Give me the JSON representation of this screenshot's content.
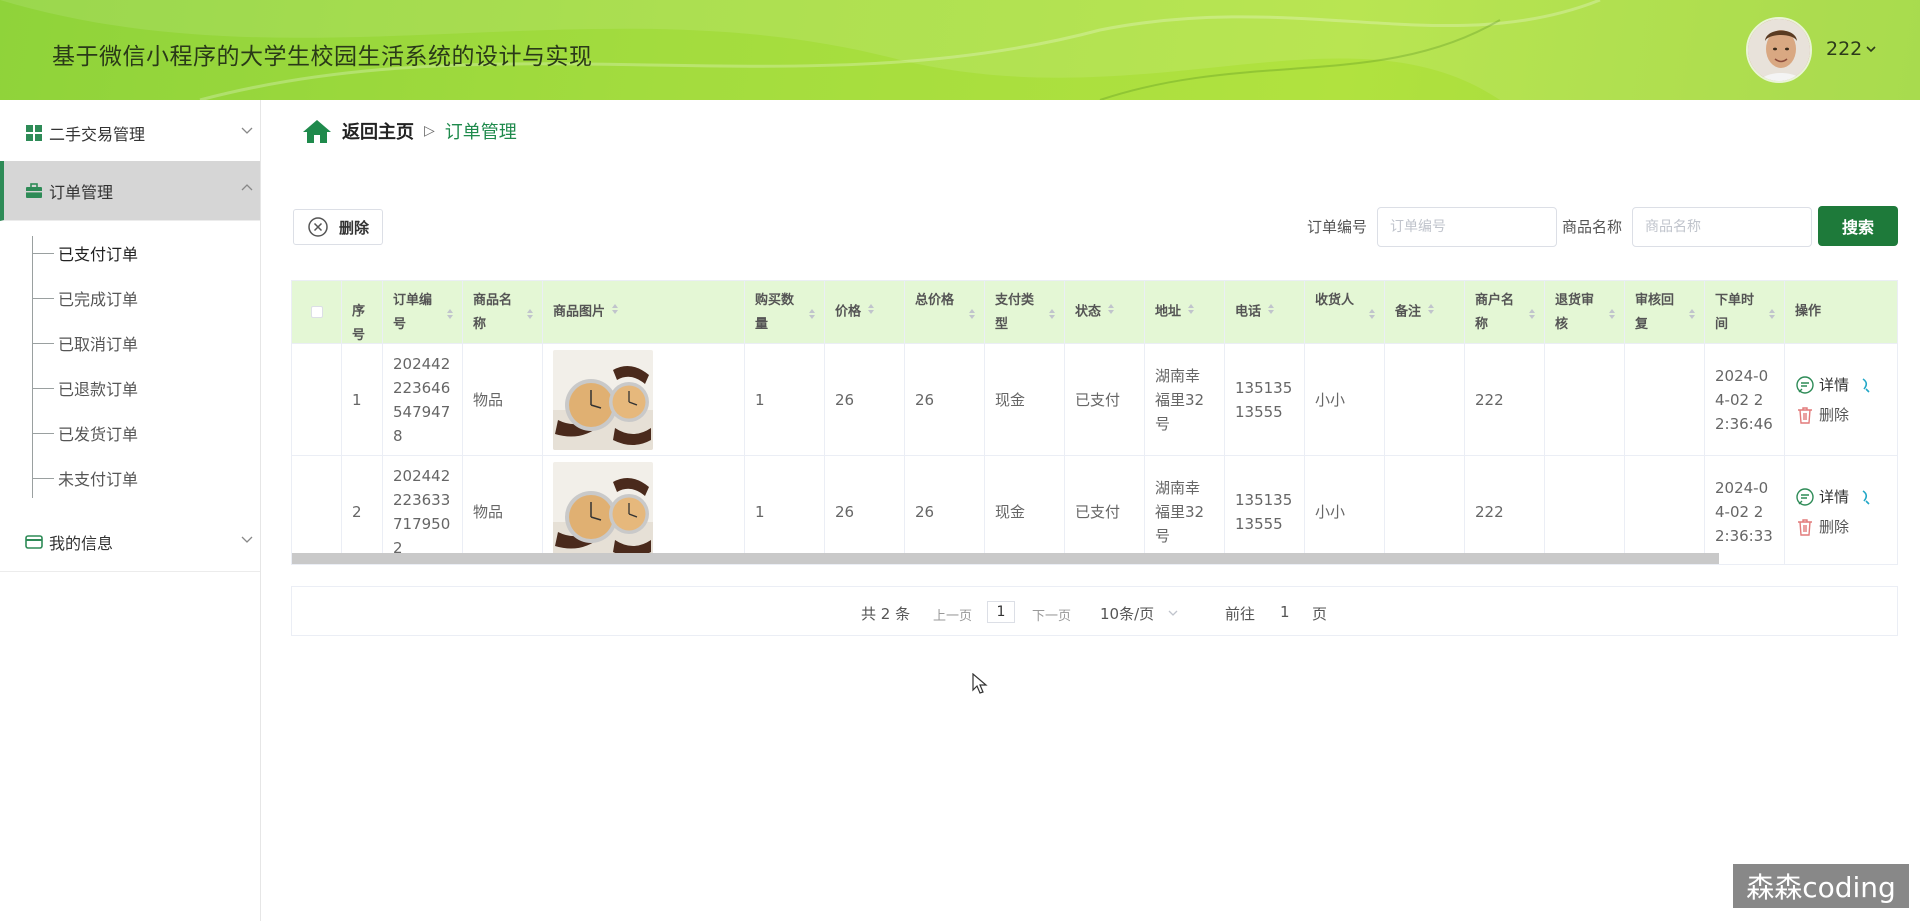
{
  "header": {
    "title": "基于微信小程序的大学生校园生活系统的设计与实现",
    "user_name": "222"
  },
  "sidebar": {
    "groups": [
      {
        "label": "二手交易管理",
        "icon": "grid-icon"
      },
      {
        "label": "订单管理",
        "icon": "briefcase-icon"
      },
      {
        "label": "我的信息",
        "icon": "card-icon"
      }
    ],
    "sub_items": [
      "已支付订单",
      "已完成订单",
      "已取消订单",
      "已退款订单",
      "已发货订单",
      "未支付订单"
    ]
  },
  "breadcrumb": {
    "home": "返回主页",
    "current": "订单管理"
  },
  "toolbar": {
    "delete_label": "删除",
    "order_no_label": "订单编号",
    "order_no_placeholder": "订单编号",
    "goods_name_label": "商品名称",
    "goods_name_placeholder": "商品名称",
    "search_label": "搜索"
  },
  "table": {
    "headers": {
      "index": "序号",
      "order_no": "订单编号",
      "goods_name": "商品名称",
      "goods_image": "商品图片",
      "quantity": "购买数量",
      "price": "价格",
      "total": "总价格",
      "pay_type": "支付类型",
      "status": "状态",
      "address": "地址",
      "phone": "电话",
      "receiver": "收货人",
      "remark": "备注",
      "merchant": "商户名称",
      "refund_review": "退货审核",
      "review_reply": "审核回复",
      "order_time": "下单时间",
      "actions": "操作"
    },
    "rows": [
      {
        "index": "1",
        "order_no": "2024422236465479478",
        "goods_name": "物品",
        "quantity": "1",
        "price": "26",
        "total": "26",
        "pay_type": "现金",
        "status": "已支付",
        "address": "湖南幸福里32号",
        "phone": "13513513555",
        "receiver": "小小",
        "remark": "",
        "merchant": "222",
        "refund_review": "",
        "review_reply": "",
        "order_time": "2024-04-02 22:36:46",
        "detail_label": "详情",
        "delete_label": "删除"
      },
      {
        "index": "2",
        "order_no": "2024422236337179502",
        "goods_name": "物品",
        "quantity": "1",
        "price": "26",
        "total": "26",
        "pay_type": "现金",
        "status": "已支付",
        "address": "湖南幸福里32号",
        "phone": "13513513555",
        "receiver": "小小",
        "remark": "",
        "merchant": "222",
        "refund_review": "",
        "review_reply": "",
        "order_time": "2024-04-02 22:36:33",
        "detail_label": "详情",
        "delete_label": "删除"
      }
    ]
  },
  "pagination": {
    "total_text": "共 2 条",
    "prev": "上一页",
    "current_page": "1",
    "next": "下一页",
    "page_size": "10条/页",
    "goto_prefix": "前往",
    "goto_value": "1",
    "goto_suffix": "页"
  },
  "watermark": "森森coding",
  "colors": {
    "header_green": "#a3dc3e",
    "accent_green": "#1e7a3a",
    "table_header_bg": "#e4f7d5"
  }
}
